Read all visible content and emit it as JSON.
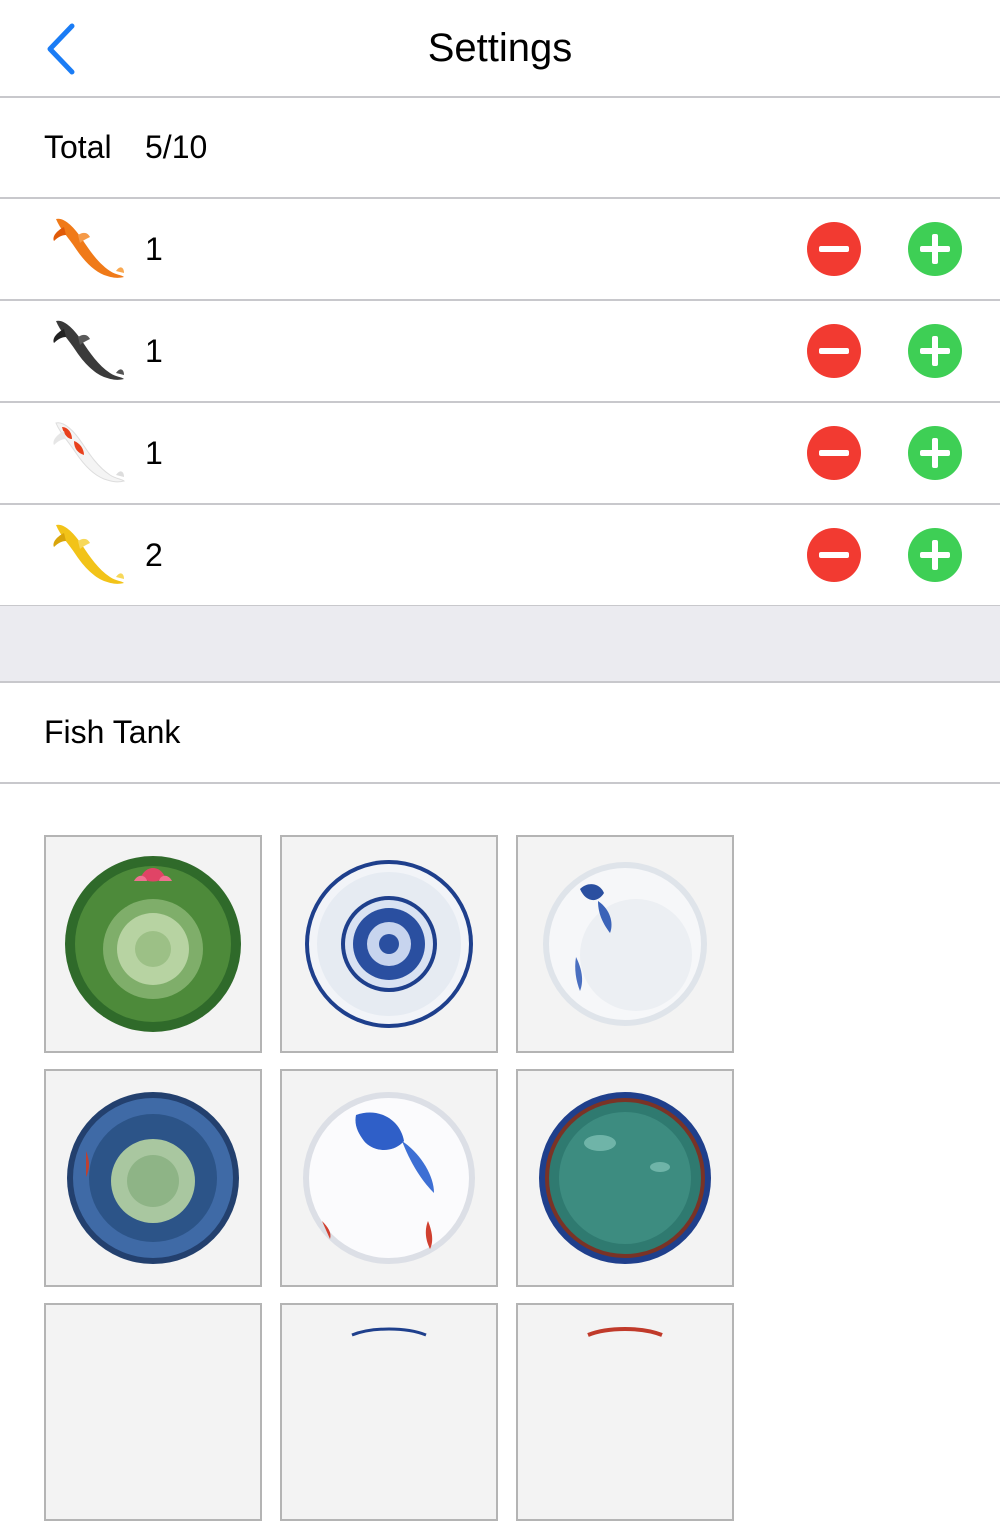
{
  "navbar": {
    "title": "Settings",
    "back_icon": "chevron-left-icon",
    "accent_color": "#1a7cf5"
  },
  "total": {
    "label": "Total",
    "value": "5/10"
  },
  "fish_rows": [
    {
      "fish": "orange-koi",
      "count": "1",
      "color": "#f07a18"
    },
    {
      "fish": "black-koi",
      "count": "1",
      "color": "#3b3b3b"
    },
    {
      "fish": "red-white-koi",
      "count": "1",
      "color": "#e8401c"
    },
    {
      "fish": "yellow-koi",
      "count": "2",
      "color": "#f2c318"
    }
  ],
  "buttons": {
    "minus_icon": "minus-circle-icon",
    "plus_icon": "plus-circle-icon",
    "minus_color": "#f23a31",
    "plus_color": "#3ecf55"
  },
  "tank_section": {
    "label": "Fish Tank",
    "tanks": [
      {
        "style": "green-lotus-bowl"
      },
      {
        "style": "blue-white-floral-bowl"
      },
      {
        "style": "blue-white-koi-plate"
      },
      {
        "style": "blue-lotus-bowl"
      },
      {
        "style": "blue-koi-painted-bowl"
      },
      {
        "style": "teal-crackle-bowl"
      }
    ]
  }
}
